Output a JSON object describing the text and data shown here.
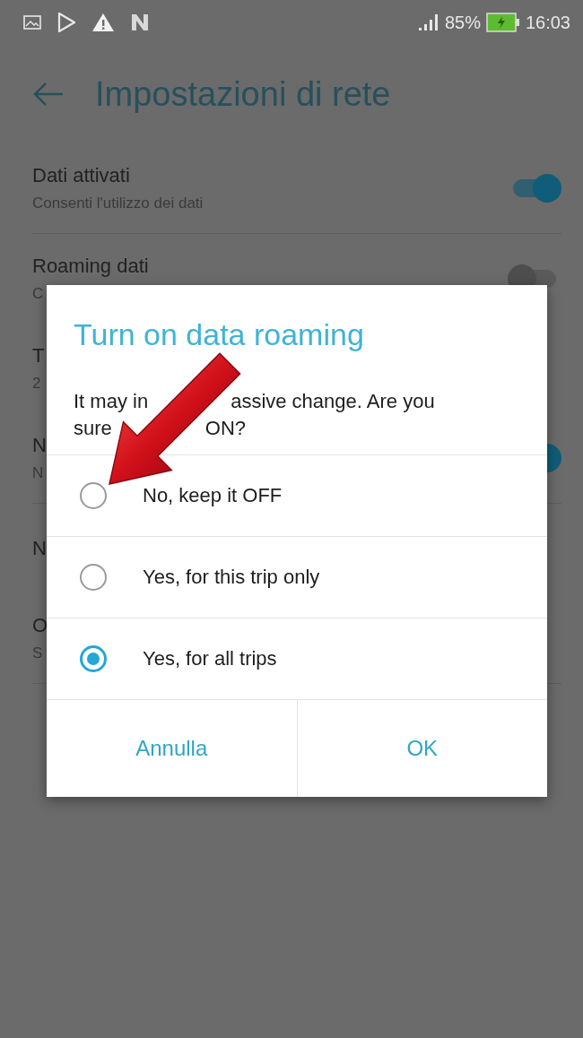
{
  "status_bar": {
    "battery": "85%",
    "time": "16:03"
  },
  "header": {
    "title": "Impostazioni di rete"
  },
  "settings": [
    {
      "title": "Dati attivati",
      "subtitle": "Consenti l'utilizzo dei dati",
      "kind": "toggle",
      "on": true
    },
    {
      "title": "Roaming dati",
      "subtitle": "C",
      "kind": "toggle",
      "on": false
    },
    {
      "title": "T",
      "subtitle": "2",
      "kind": "text"
    },
    {
      "title": "N",
      "subtitle": "N",
      "kind": "toggle",
      "on": true
    },
    {
      "title": "N",
      "kind": "text"
    },
    {
      "title": "O",
      "subtitle": "S",
      "kind": "text"
    }
  ],
  "dialog": {
    "title": "Turn on data roaming",
    "message_lines": [
      [
        "It may in",
        "assive change. Are you"
      ],
      [
        "sure",
        "ON?"
      ]
    ],
    "options": [
      {
        "label": "No, keep it OFF",
        "selected": false
      },
      {
        "label": "Yes, for this trip only",
        "selected": false
      },
      {
        "label": "Yes, for all trips",
        "selected": true
      }
    ],
    "buttons": [
      "Annulla",
      "OK"
    ]
  }
}
